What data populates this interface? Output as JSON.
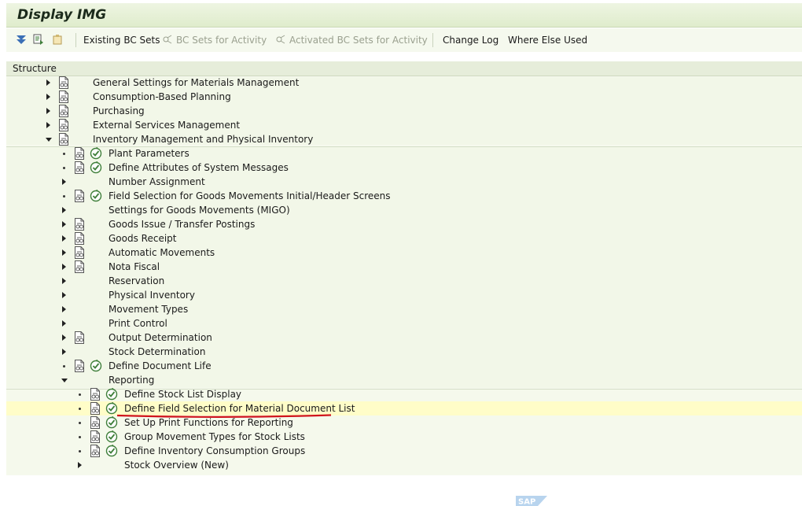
{
  "window": {
    "title": "Display IMG"
  },
  "toolbar": {
    "existing_bc_sets": "Existing BC Sets",
    "bc_sets_for_activity": "BC Sets for Activity",
    "activated_bc_sets": "Activated BC Sets for Activity",
    "change_log": "Change Log",
    "where_else_used": "Where Else Used"
  },
  "structure": {
    "header": "Structure",
    "level1": [
      "General Settings for Materials Management",
      "Consumption-Based Planning",
      "Purchasing",
      "External Services Management",
      "Inventory Management and Physical Inventory"
    ],
    "level2": [
      "Plant Parameters",
      "Define Attributes of System Messages",
      "Number Assignment",
      "Field Selection for Goods Movements Initial/Header Screens",
      "Settings for Goods Movements (MIGO)",
      "Goods Issue / Transfer Postings",
      "Goods Receipt",
      "Automatic Movements",
      "Nota Fiscal",
      "Reservation",
      "Physical Inventory",
      "Movement Types",
      "Print Control",
      "Output Determination",
      "Stock Determination",
      "Define Document Life",
      "Reporting"
    ],
    "level3": [
      "Define Stock List Display",
      "Define Field Selection for Material Document List",
      "Set Up Print Functions for Reporting",
      "Group Movement Types for Stock Lists",
      "Define Inventory Consumption Groups",
      "Stock Overview (New)"
    ]
  },
  "logo_text": "SAP",
  "colors": {
    "highlight": "#fffdc8",
    "underline": "#d0141c",
    "icon_green": "#3f7f3a"
  }
}
